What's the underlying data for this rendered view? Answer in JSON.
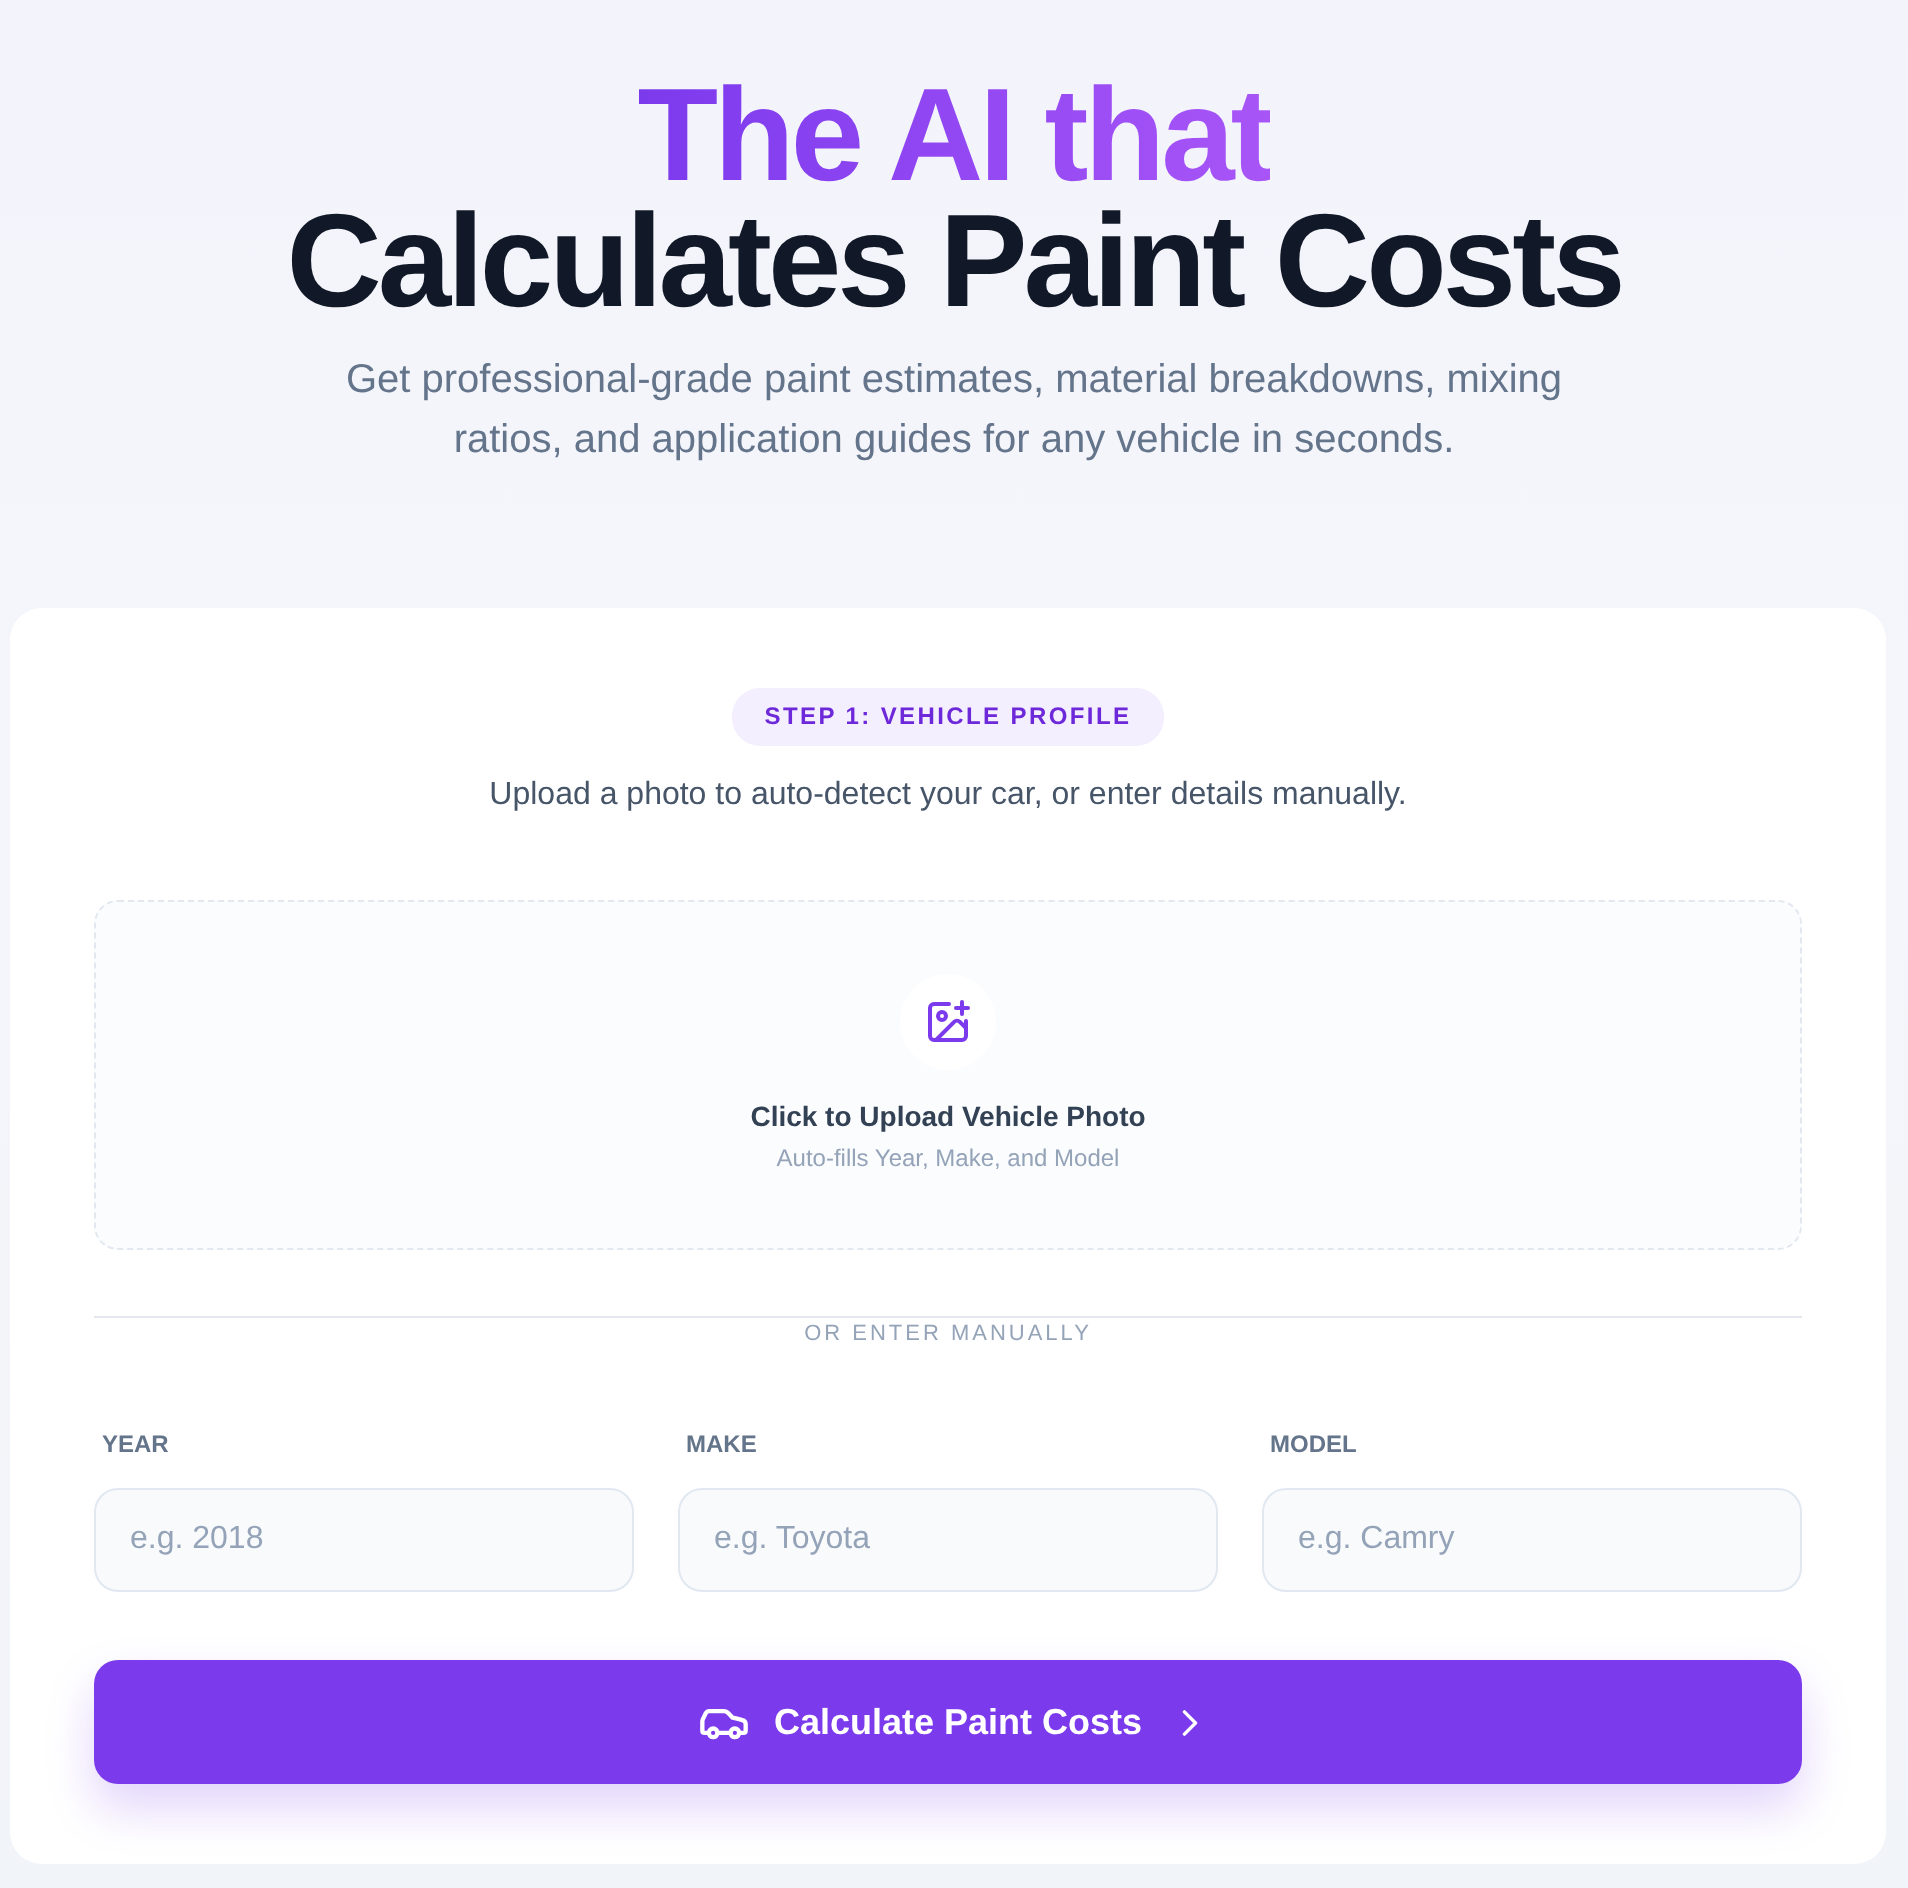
{
  "hero": {
    "title_highlight": "The AI that",
    "title": "Calculates Paint Costs",
    "subtitle": "Get professional-grade paint estimates, material breakdowns, mixing ratios, and application guides for any vehicle in seconds."
  },
  "card": {
    "step_badge": "STEP 1: VEHICLE PROFILE",
    "instructions": "Upload a photo to auto-detect your car, or enter details manually.",
    "upload": {
      "title": "Click to Upload Vehicle Photo",
      "hint": "Auto-fills Year, Make, and Model"
    },
    "divider_label": "OR ENTER MANUALLY",
    "fields": [
      {
        "label": "YEAR",
        "placeholder": "e.g. 2018"
      },
      {
        "label": "MAKE",
        "placeholder": "e.g. Toyota"
      },
      {
        "label": "MODEL",
        "placeholder": "e.g. Camry"
      }
    ],
    "submit_button": {
      "label": "Calculate Paint Costs"
    }
  }
}
